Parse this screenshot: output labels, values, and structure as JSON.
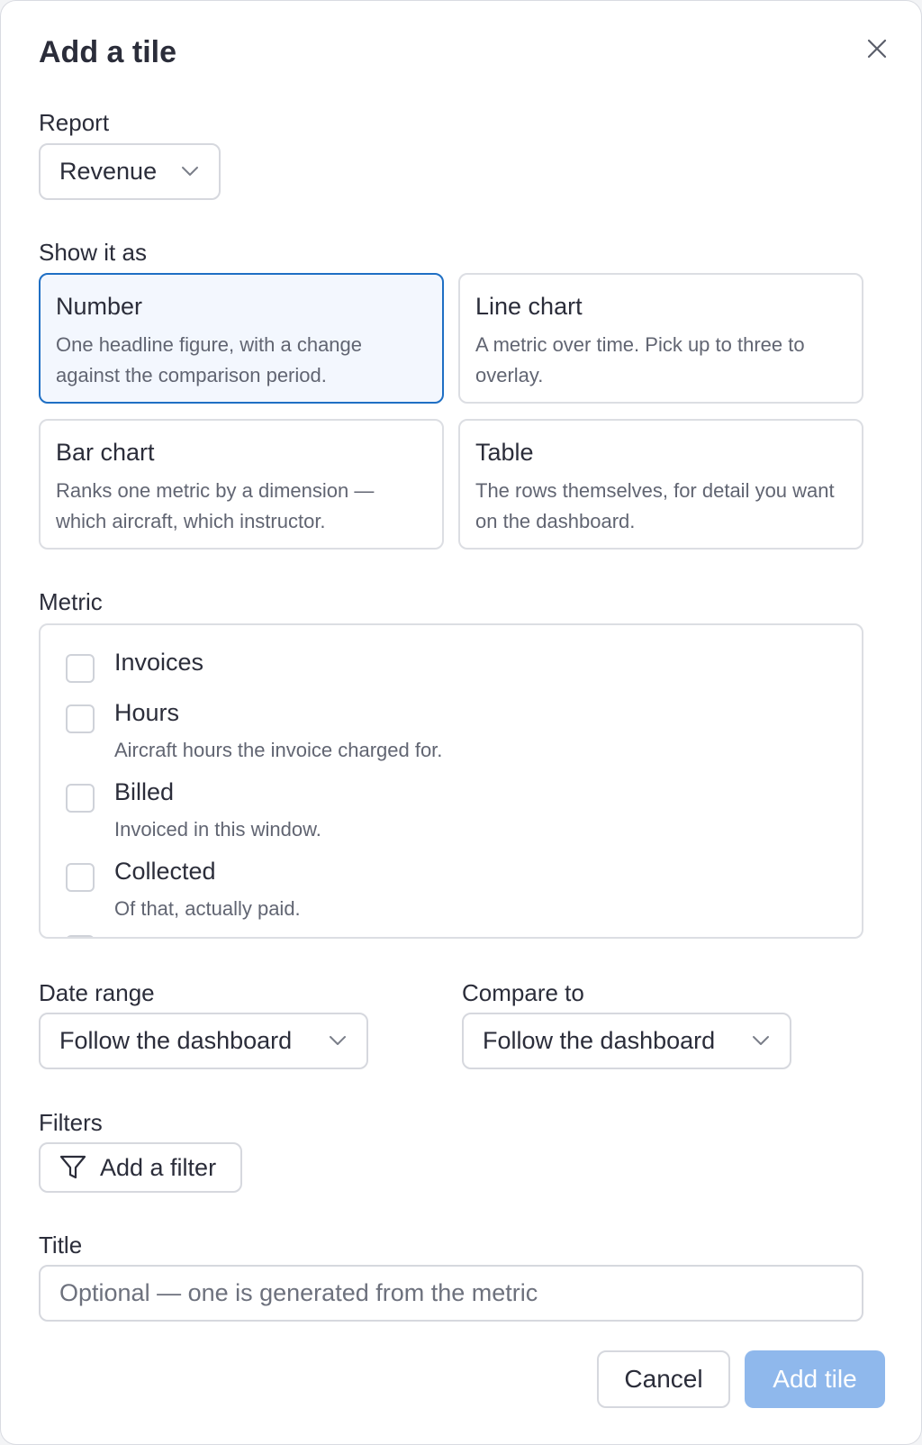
{
  "dialog": {
    "title": "Add a tile",
    "close_icon": "close-icon"
  },
  "report": {
    "label": "Report",
    "value": "Revenue",
    "icon": "chevron-down-icon"
  },
  "show_as": {
    "label": "Show it as",
    "selected": "Number",
    "options": [
      {
        "title": "Number",
        "description": "One headline figure, with a change against the comparison period."
      },
      {
        "title": "Line chart",
        "description": "A metric over time. Pick up to three to overlay."
      },
      {
        "title": "Bar chart",
        "description": "Ranks one metric by a dimension — which aircraft, which instructor."
      },
      {
        "title": "Table",
        "description": "The rows themselves, for detail you want on the dashboard."
      }
    ],
    "selected_color": "#1f6fc4"
  },
  "metric": {
    "label": "Metric",
    "items": [
      {
        "name": "Invoices",
        "description": "",
        "checked": false
      },
      {
        "name": "Hours",
        "description": "Aircraft hours the invoice charged for.",
        "checked": false
      },
      {
        "name": "Billed",
        "description": "Invoiced in this window.",
        "checked": false
      },
      {
        "name": "Collected",
        "description": "Of that, actually paid.",
        "checked": false
      }
    ]
  },
  "date_range": {
    "label": "Date range",
    "value": "Follow the dashboard"
  },
  "compare_to": {
    "label": "Compare to",
    "value": "Follow the dashboard"
  },
  "filters": {
    "label": "Filters",
    "button_label": "Add a filter",
    "icon": "filter-icon"
  },
  "title_field": {
    "label": "Title",
    "value": "",
    "placeholder": "Optional — one is generated from the metric"
  },
  "footer": {
    "cancel_label": "Cancel",
    "add_label": "Add tile",
    "add_color": "#8fb8ec"
  }
}
